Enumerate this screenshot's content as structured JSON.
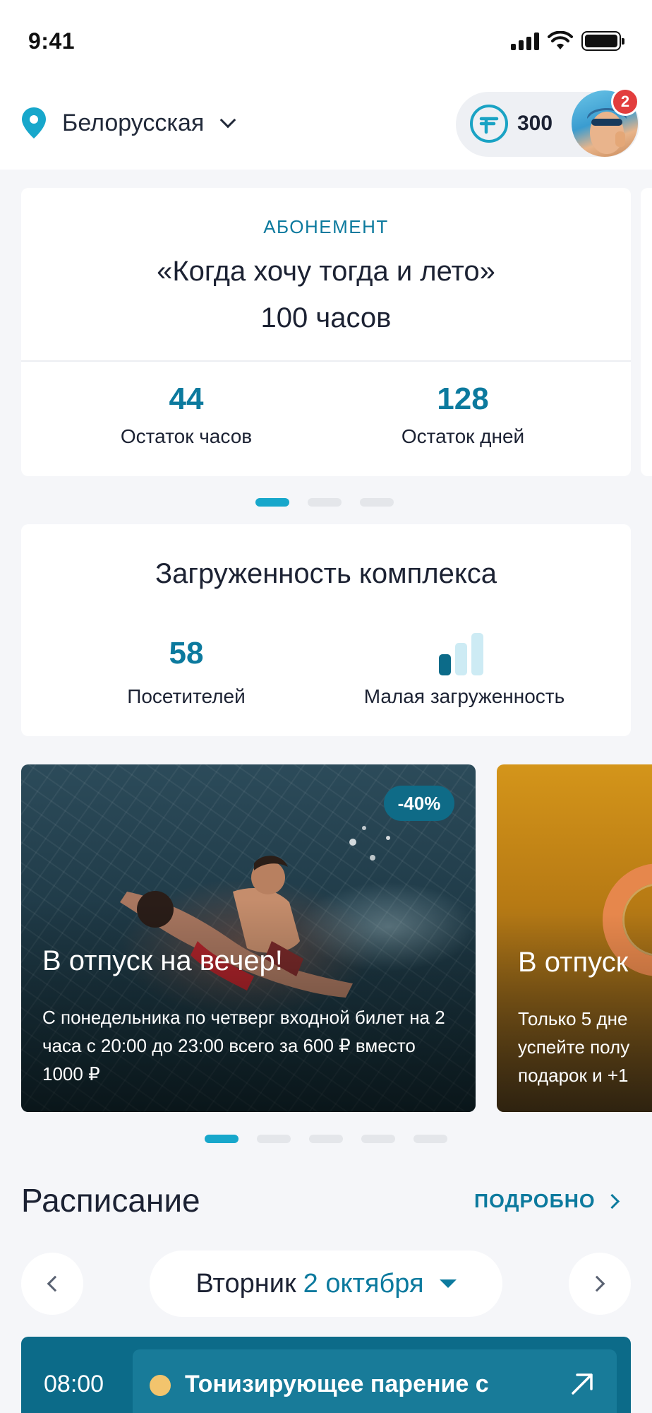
{
  "status_bar": {
    "time": "9:41"
  },
  "header": {
    "location": "Белорусская",
    "points": "300",
    "notifications": "2"
  },
  "subscription": {
    "kicker": "АБОНЕМЕНТ",
    "title": "«Когда хочу тогда и лето»",
    "hours": "100 часов",
    "stats": [
      {
        "value": "44",
        "label": "Остаток часов"
      },
      {
        "value": "128",
        "label": "Остаток дней"
      }
    ],
    "pager": {
      "count": 3,
      "active": 0
    }
  },
  "load": {
    "title": "Загруженность комплекса",
    "visitors": "58",
    "visitors_label": "Посетителей",
    "level_label": "Малая загруженность",
    "level": 1,
    "level_max": 3
  },
  "promos": [
    {
      "discount": "-40%",
      "title": "В отпуск на вечер!",
      "text": "С понедельника по четверг входной билет на 2 часа с 20:00 до 23:00 всего за 600 ₽ вместо 1000 ₽"
    },
    {
      "title": "В отпуск",
      "text": "Только 5 дне\nуспейте полу\nподарок и +1"
    }
  ],
  "promo_pager": {
    "count": 5,
    "active": 0
  },
  "schedule": {
    "title": "Расписание",
    "more_label": "ПОДРОБНО",
    "day": "Вторник",
    "date": "2 октября",
    "event": {
      "time": "08:00",
      "name": "Тонизирующее парение с"
    }
  },
  "colors": {
    "accent": "#0c7a9e",
    "accent_light": "#17a7cb",
    "background": "#f5f6f9",
    "badge": "#e23d3d",
    "event_card": "#0c6b89"
  }
}
